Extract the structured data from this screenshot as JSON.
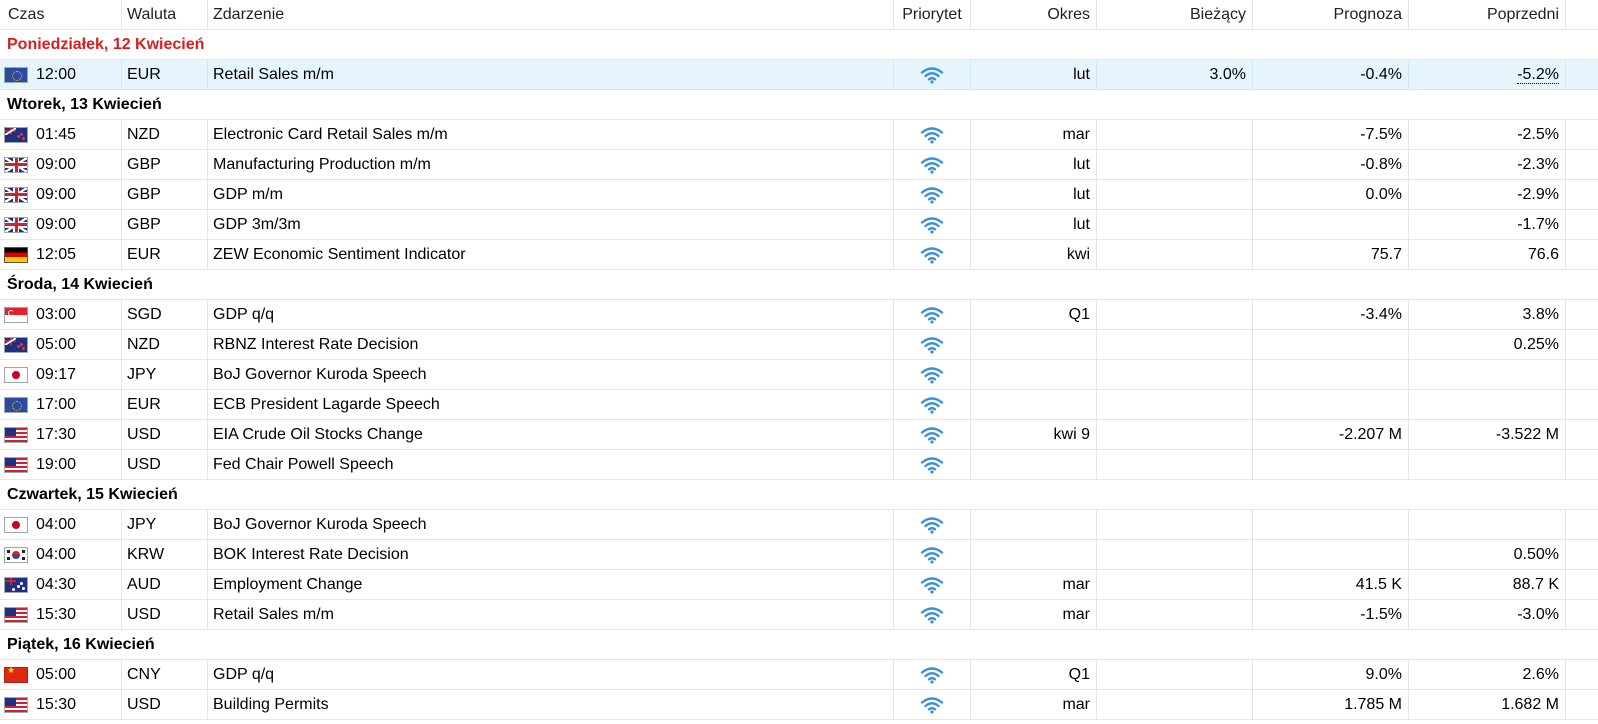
{
  "columns": {
    "time": "Czas",
    "currency": "Waluta",
    "event": "Zdarzenie",
    "priority": "Priorytet",
    "period": "Okres",
    "actual": "Bieżący",
    "forecast": "Prognoza",
    "previous": "Poprzedni"
  },
  "colors": {
    "today": "#d81e1e",
    "priority_icon": "#3d8fdc",
    "selected_row": "#e6f4fb"
  },
  "groups": [
    {
      "day": "Poniedziałek, 12 Kwiecień",
      "today": true,
      "rows": [
        {
          "flag": "eu-flag-icon",
          "time": "12:00",
          "currency": "EUR",
          "event": "Retail Sales m/m",
          "period": "lut",
          "actual": "3.0%",
          "forecast": "-0.4%",
          "previous": "-5.2%",
          "selected": true
        }
      ]
    },
    {
      "day": "Wtorek, 13 Kwiecień",
      "rows": [
        {
          "flag": "nz-flag-icon",
          "time": "01:45",
          "currency": "NZD",
          "event": "Electronic Card Retail Sales m/m",
          "period": "mar",
          "actual": "",
          "forecast": "-7.5%",
          "previous": "-2.5%"
        },
        {
          "flag": "gb-flag-icon",
          "time": "09:00",
          "currency": "GBP",
          "event": "Manufacturing Production m/m",
          "period": "lut",
          "actual": "",
          "forecast": "-0.8%",
          "previous": "-2.3%"
        },
        {
          "flag": "gb-flag-icon",
          "time": "09:00",
          "currency": "GBP",
          "event": "GDP m/m",
          "period": "lut",
          "actual": "",
          "forecast": "0.0%",
          "previous": "-2.9%"
        },
        {
          "flag": "gb-flag-icon",
          "time": "09:00",
          "currency": "GBP",
          "event": "GDP 3m/3m",
          "period": "lut",
          "actual": "",
          "forecast": "",
          "previous": "-1.7%"
        },
        {
          "flag": "de-flag-icon",
          "time": "12:05",
          "currency": "EUR",
          "event": "ZEW Economic Sentiment Indicator",
          "period": "kwi",
          "actual": "",
          "forecast": "75.7",
          "previous": "76.6"
        }
      ]
    },
    {
      "day": "Środa, 14 Kwiecień",
      "rows": [
        {
          "flag": "sg-flag-icon",
          "time": "03:00",
          "currency": "SGD",
          "event": "GDP q/q",
          "period": "Q1",
          "actual": "",
          "forecast": "-3.4%",
          "previous": "3.8%"
        },
        {
          "flag": "nz-flag-icon",
          "time": "05:00",
          "currency": "NZD",
          "event": "RBNZ Interest Rate Decision",
          "period": "",
          "actual": "",
          "forecast": "",
          "previous": "0.25%"
        },
        {
          "flag": "jp-flag-icon",
          "time": "09:17",
          "currency": "JPY",
          "event": "BoJ Governor Kuroda Speech",
          "period": "",
          "actual": "",
          "forecast": "",
          "previous": ""
        },
        {
          "flag": "eu-flag-icon",
          "time": "17:00",
          "currency": "EUR",
          "event": "ECB President Lagarde Speech",
          "period": "",
          "actual": "",
          "forecast": "",
          "previous": ""
        },
        {
          "flag": "us-flag-icon",
          "time": "17:30",
          "currency": "USD",
          "event": "EIA Crude Oil Stocks Change",
          "period": "kwi 9",
          "actual": "",
          "forecast": "-2.207 M",
          "previous": "-3.522 M"
        },
        {
          "flag": "us-flag-icon",
          "time": "19:00",
          "currency": "USD",
          "event": "Fed Chair Powell Speech",
          "period": "",
          "actual": "",
          "forecast": "",
          "previous": ""
        }
      ]
    },
    {
      "day": "Czwartek, 15 Kwiecień",
      "rows": [
        {
          "flag": "jp-flag-icon",
          "time": "04:00",
          "currency": "JPY",
          "event": "BoJ Governor Kuroda Speech",
          "period": "",
          "actual": "",
          "forecast": "",
          "previous": ""
        },
        {
          "flag": "kr-flag-icon",
          "time": "04:00",
          "currency": "KRW",
          "event": "BOK Interest Rate Decision",
          "period": "",
          "actual": "",
          "forecast": "",
          "previous": "0.50%"
        },
        {
          "flag": "au-flag-icon",
          "time": "04:30",
          "currency": "AUD",
          "event": "Employment Change",
          "period": "mar",
          "actual": "",
          "forecast": "41.5 K",
          "previous": "88.7 K"
        },
        {
          "flag": "us-flag-icon",
          "time": "15:30",
          "currency": "USD",
          "event": "Retail Sales m/m",
          "period": "mar",
          "actual": "",
          "forecast": "-1.5%",
          "previous": "-3.0%"
        }
      ]
    },
    {
      "day": "Piątek, 16 Kwiecień",
      "rows": [
        {
          "flag": "cn-flag-icon",
          "time": "05:00",
          "currency": "CNY",
          "event": "GDP q/q",
          "period": "Q1",
          "actual": "",
          "forecast": "9.0%",
          "previous": "2.6%"
        },
        {
          "flag": "us-flag-icon",
          "time": "15:30",
          "currency": "USD",
          "event": "Building Permits",
          "period": "mar",
          "actual": "",
          "forecast": "1.785 M",
          "previous": "1.682 M"
        }
      ]
    }
  ]
}
